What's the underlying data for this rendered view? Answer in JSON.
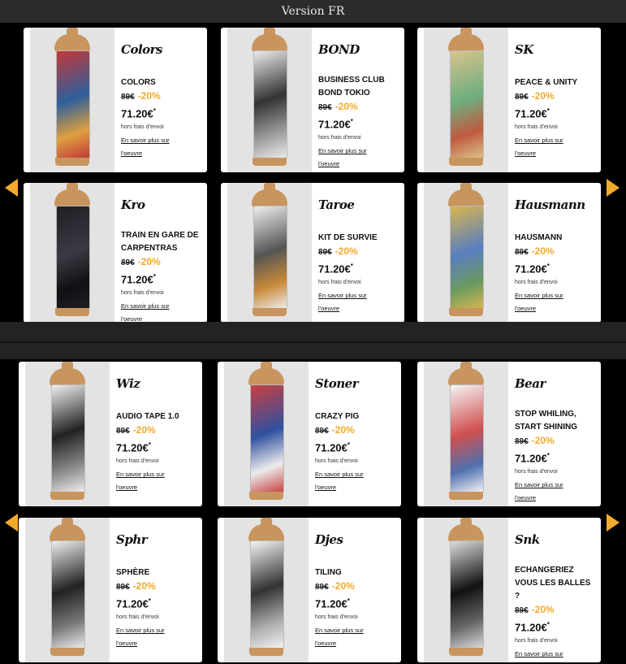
{
  "header": {
    "title": "Version FR"
  },
  "colors": {
    "accent": "#f2aa2c",
    "panel_bg": "#000000",
    "page_bg": "#222222"
  },
  "panels": [
    {
      "products": [
        {
          "signature": "Colors",
          "title": "COLORS",
          "old_price": "89€",
          "discount": "-20%",
          "price": "71.20€",
          "asterisk": "*",
          "shipping": "hors frais d'envoi",
          "link": "En savoir plus sur l'oeuvre",
          "colors": [
            "#c03838",
            "#2f5f9c",
            "#e0a040"
          ]
        },
        {
          "signature": "BOND",
          "title": "BUSINESS CLUB BOND TOKIO",
          "old_price": "89€",
          "discount": "-20%",
          "price": "71.20€",
          "asterisk": "*",
          "shipping": "hors frais d'envoi",
          "link": "En savoir plus sur l'oeuvre",
          "colors": [
            "#ececec",
            "#333333",
            "#9a9a9a"
          ]
        },
        {
          "signature": "SK",
          "title": "PEACE & UNITY",
          "old_price": "89€",
          "discount": "-20%",
          "price": "71.20€",
          "asterisk": "*",
          "shipping": "hors frais d'envoi",
          "link": "En savoir plus sur l'oeuvre",
          "colors": [
            "#d9c48c",
            "#6fae80",
            "#c05a40"
          ]
        },
        {
          "signature": "Kro",
          "title": "TRAIN EN GARE DE CARPENTRAS",
          "old_price": "89€",
          "discount": "-20%",
          "price": "71.20€",
          "asterisk": "*",
          "shipping": "hors frais d'envoi",
          "link": "En savoir plus sur l'oeuvre",
          "colors": [
            "#1e1e24",
            "#3a3a44",
            "#111114"
          ]
        },
        {
          "signature": "Taroe",
          "title": "KIT DE SURVIE",
          "old_price": "89€",
          "discount": "-20%",
          "price": "71.20€",
          "asterisk": "*",
          "shipping": "hors frais d'envoi",
          "link": "En savoir plus sur l'oeuvre",
          "colors": [
            "#eeeeee",
            "#555555",
            "#c98a3a"
          ]
        },
        {
          "signature": "Hausmann",
          "title": "HAUSMANN",
          "old_price": "89€",
          "discount": "-20%",
          "price": "71.20€",
          "asterisk": "*",
          "shipping": "hors frais d'envoi",
          "link": "En savoir plus sur l'oeuvre",
          "colors": [
            "#d8b650",
            "#5a7ec0",
            "#6a9a60"
          ]
        }
      ]
    },
    {
      "products": [
        {
          "signature": "Wiz",
          "title": "AUDIO TAPE 1.0",
          "old_price": "89€",
          "discount": "-20%",
          "price": "71.20€",
          "asterisk": "*",
          "shipping": "hors frais d'envoi",
          "link": "En savoir plus sur l'oeuvre",
          "colors": [
            "#f0f0f0",
            "#222222",
            "#888888"
          ]
        },
        {
          "signature": "Stoner",
          "title": "CRAZY PIG",
          "old_price": "89€",
          "discount": "-20%",
          "price": "71.20€",
          "asterisk": "*",
          "shipping": "hors frais d'envoi",
          "link": "En savoir plus sur l'oeuvre",
          "colors": [
            "#c84040",
            "#3050a0",
            "#ececec"
          ]
        },
        {
          "signature": "Bear",
          "title": "STOP WHILING, START SHINING",
          "old_price": "89€",
          "discount": "-20%",
          "price": "71.20€",
          "asterisk": "*",
          "shipping": "hors frais d'envoi",
          "link": "En savoir plus sur l'oeuvre",
          "colors": [
            "#f5f5f5",
            "#d05050",
            "#5070b0"
          ]
        },
        {
          "signature": "Sphr",
          "title": "SPHÈRE",
          "old_price": "89€",
          "discount": "-20%",
          "price": "71.20€",
          "asterisk": "*",
          "shipping": "hors frais d'envoi",
          "link": "En savoir plus sur l'oeuvre",
          "colors": [
            "#eeeeee",
            "#222222",
            "#777777"
          ]
        },
        {
          "signature": "Djes",
          "title": "TILING",
          "old_price": "89€",
          "discount": "-20%",
          "price": "71.20€",
          "asterisk": "*",
          "shipping": "hors frais d'envoi",
          "link": "En savoir plus sur l'oeuvre",
          "colors": [
            "#f4f4f4",
            "#333333",
            "#aaaaaa"
          ]
        },
        {
          "signature": "Snk",
          "title": "ECHANGERIEZ VOUS LES BALLES ?",
          "old_price": "89€",
          "discount": "-20%",
          "price": "71.20€",
          "asterisk": "*",
          "shipping": "hors frais d'envoi",
          "link": "En savoir plus sur l'oeuvre",
          "colors": [
            "#dddddd",
            "#111111",
            "#666666"
          ]
        }
      ]
    }
  ]
}
